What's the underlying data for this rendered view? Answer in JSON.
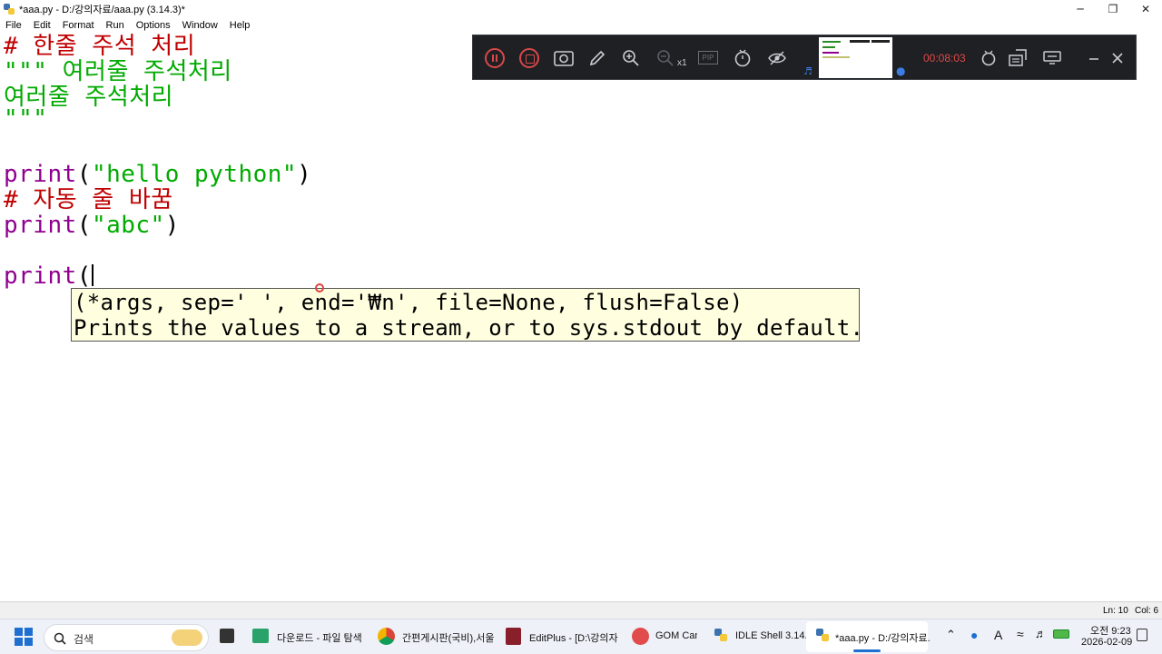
{
  "window": {
    "title": "*aaa.py - D:/강의자료/aaa.py (3.14.3)*",
    "minimize": "─",
    "restore": "❐",
    "close": "✕"
  },
  "menu": [
    "File",
    "Edit",
    "Format",
    "Run",
    "Options",
    "Window",
    "Help"
  ],
  "code": {
    "line1": "# 한줄 주석 처리",
    "line2": "\"\"\" 여러줄 주석처리",
    "line3": "여러줄 주석처리",
    "line4": "\"\"\"",
    "line5_kw": "print",
    "line5_open": "(",
    "line5_str": "\"hello python\"",
    "line5_close": ")",
    "line6": "# 자동 줄 바꿈",
    "line7_kw": "print",
    "line7_open": "(",
    "line7_str": "\"abc\"",
    "line7_close": ")",
    "line8_kw": "print",
    "line8_open": "("
  },
  "calltip": {
    "signature": "(*args, sep=' ', end='₩n', file=None, flush=False)",
    "doc": "Prints the values to a stream, or to sys.stdout by default."
  },
  "recorder": {
    "zoom_level": "x1",
    "pip_label": "PIP",
    "elapsed": "00:08:03",
    "icons": [
      "pause-icon",
      "stop-icon",
      "camera-icon",
      "pencil-icon",
      "zoom-in-icon",
      "zoom-out-icon",
      "pip-icon",
      "timer-icon",
      "hide-icon",
      "thumbnail",
      "settings-icon",
      "capture-icon",
      "screen-icon",
      "minimize-icon",
      "close-icon"
    ],
    "accent_color": "#e04848"
  },
  "status": {
    "line": "Ln: 10",
    "col": "Col: 6"
  },
  "taskbar": {
    "search_placeholder": "검색",
    "apps": [
      {
        "label": "다운로드 - 파일 탐색",
        "icon": "file-explorer-icon"
      },
      {
        "label": "간편게시판(국비),서울",
        "icon": "chrome-icon"
      },
      {
        "label": "EditPlus - [D:\\강의자료",
        "icon": "editplus-icon"
      },
      {
        "label": "GOM Cam",
        "icon": "gomcam-icon"
      },
      {
        "label": "IDLE Shell 3.14.",
        "icon": "python-icon"
      },
      {
        "label": "*aaa.py - D:/강의자료.",
        "icon": "python-icon"
      }
    ],
    "time": "오전 9:23",
    "date": "2026-02-09",
    "ime": "A"
  }
}
